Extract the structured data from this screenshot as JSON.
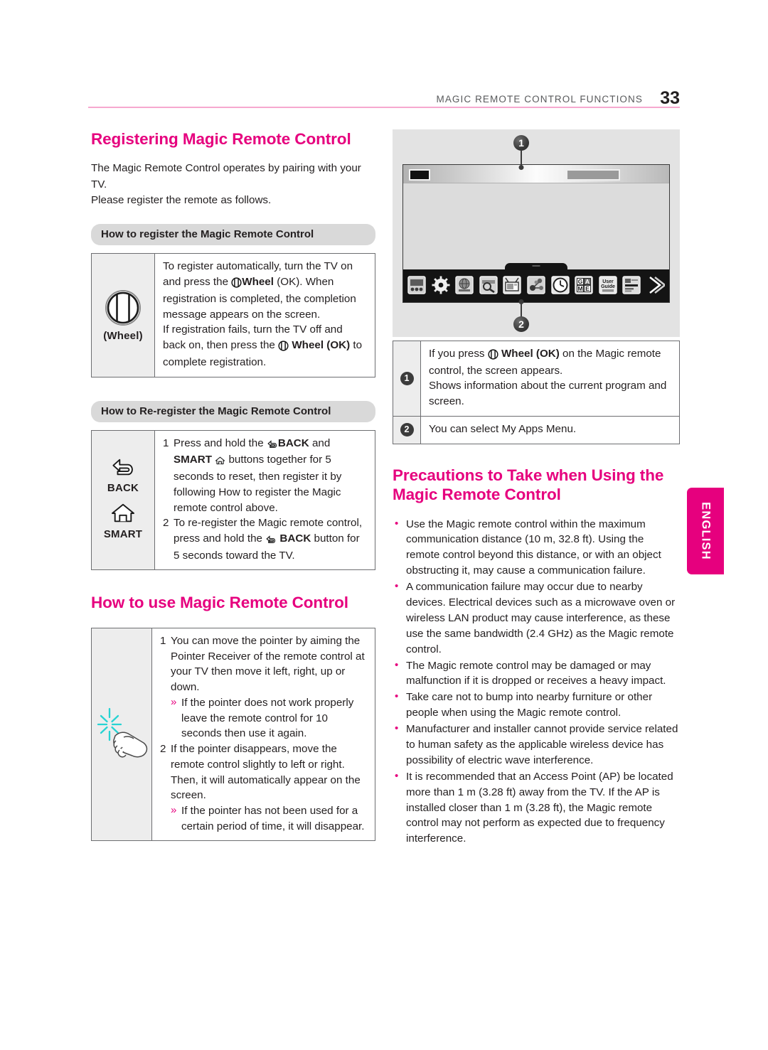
{
  "header": {
    "title": "MAGIC REMOTE CONTROL FUNCTIONS",
    "page_number": "33",
    "rule_color": "#f6a8cf"
  },
  "accent_color": "#e6007e",
  "language_tab": {
    "label": "ENGLISH"
  },
  "left_column": {
    "registering": {
      "heading": "Registering Magic Remote Control",
      "intro": "The Magic Remote Control operates by pairing with your TV.\nPlease register the remote as follows.",
      "subheading_register": "How to register the Magic Remote Control",
      "register_row": {
        "key_label": "(Wheel)",
        "key_icon": "wheel-icon",
        "text_part1": "To register automatically, turn the TV on and press the ",
        "wheel_bold": "Wheel",
        "text_part2": " (OK). When registration is completed, the completion message appears on the screen.",
        "text_part3": "If registration fails, turn the TV off and back on, then press the ",
        "wheel_ok_bold": "Wheel (OK)",
        "text_part4": " to complete registration."
      },
      "subheading_reregister": "How to Re-register the Magic Remote Control",
      "reregister_rows": {
        "key1_label": "BACK",
        "key1_icon": "back-arrow-icon",
        "key2_label": "SMART",
        "key2_icon": "home-icon",
        "item1_marker": "1",
        "item1_a": "Press and hold the ",
        "item1_back": "BACK",
        "item1_b": " and ",
        "item1_smart": "SMART",
        "item1_c": " buttons together for 5 seconds to reset, then register it by following How to register the Magic remote control above.",
        "item2_marker": "2",
        "item2_a": "To re-register the Magic remote control, press and hold the ",
        "item2_back": "BACK",
        "item2_b": " button for 5 seconds toward the TV."
      }
    },
    "howtouse": {
      "heading": "How to use Magic Remote Control",
      "key_icon": "pointing-hand-icon",
      "item1_marker": "1",
      "item1_text": "You can move the pointer by aiming the Pointer Receiver of the remote control at your TV then move it left, right, up or down.",
      "item1_sub_marker": "»",
      "item1_sub_text": "If the pointer does not work properly leave the remote control for 10 seconds then use it again.",
      "item2_marker": "2",
      "item2_text": "If the pointer disappears, move the remote control slightly to left or right. Then, it will automatically appear on the screen.",
      "item2_sub_marker": "»",
      "item2_sub_text": "If the pointer has not been used for a certain period of time, it will disappear."
    }
  },
  "right_column": {
    "tv_figure": {
      "callout_1": "1",
      "callout_2": "2",
      "dock_icons": [
        "tv-recording-icon",
        "settings-gear-icon",
        "internet-globe-icon",
        "search-magnifier-icon",
        "tv-channel-icon",
        "social-network-icon",
        "clock-icon",
        "game-icon",
        "user-guide-icon",
        "input-list-icon",
        "more-arrow-icon"
      ],
      "game_icon_text": "G M E",
      "user_guide_icon_text": "User Guide"
    },
    "callout_table": {
      "rows": [
        {
          "number": "1",
          "text_a": "If you press ",
          "bold": "Wheel (OK)",
          "text_b": " on the Magic remote control, the screen appears.",
          "text_c": "Shows information about the current program and screen."
        },
        {
          "number": "2",
          "text_a": "You can select My Apps Menu.",
          "bold": "",
          "text_b": "",
          "text_c": ""
        }
      ]
    },
    "precautions": {
      "heading": "Precautions to Take when Using the Magic Remote Control",
      "items": [
        "Use the Magic remote control within the maximum communication distance (10 m, 32.8 ft). Using the remote control beyond this distance, or with an object obstructing it, may cause a communication failure.",
        "A communication failure may occur due to nearby devices. Electrical devices such as a microwave oven or wireless LAN product may cause interference, as these use the same bandwidth (2.4 GHz) as the Magic remote control.",
        "The Magic remote control may be damaged or may malfunction if it is dropped or receives a heavy impact.",
        "Take care not to bump into nearby furniture or other people when using the Magic remote control.",
        "Manufacturer and installer cannot provide service related to human safety as the applicable wireless device has possibility of electric wave interference.",
        "It is recommended that an Access Point (AP) be located more than 1 m (3.28 ft) away from the TV. If the AP is installed closer than 1 m (3.28 ft), the Magic remote control may not perform as expected due to frequency interference."
      ]
    }
  }
}
